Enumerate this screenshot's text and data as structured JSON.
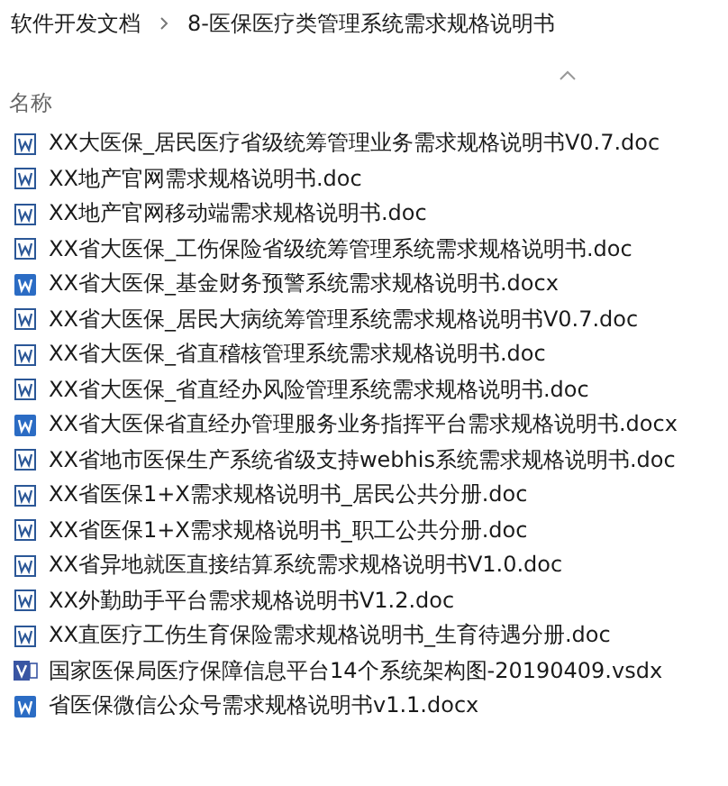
{
  "breadcrumb": [
    {
      "label": "软件开发文档"
    },
    {
      "label": "8-医保医疗类管理系统需求规格说明书"
    }
  ],
  "column_header": {
    "label": "名称",
    "sorted_ascending": true
  },
  "files": [
    {
      "name": "XX大医保_居民医疗省级统筹管理业务需求规格说明书V0.7.doc",
      "kind": "doc"
    },
    {
      "name": "XX地产官网需求规格说明书.doc",
      "kind": "doc"
    },
    {
      "name": "XX地产官网移动端需求规格说明书.doc",
      "kind": "doc"
    },
    {
      "name": "XX省大医保_工伤保险省级统筹管理系统需求规格说明书.doc",
      "kind": "doc"
    },
    {
      "name": "XX省大医保_基金财务预警系统需求规格说明书.docx",
      "kind": "docx"
    },
    {
      "name": "XX省大医保_居民大病统筹管理系统需求规格说明书V0.7.doc",
      "kind": "doc"
    },
    {
      "name": "XX省大医保_省直稽核管理系统需求规格说明书.doc",
      "kind": "doc"
    },
    {
      "name": "XX省大医保_省直经办风险管理系统需求规格说明书.doc",
      "kind": "doc"
    },
    {
      "name": "XX省大医保省直经办管理服务业务指挥平台需求规格说明书.docx",
      "kind": "docx"
    },
    {
      "name": "XX省地市医保生产系统省级支持webhis系统需求规格说明书.doc",
      "kind": "doc"
    },
    {
      "name": "XX省医保1+X需求规格说明书_居民公共分册.doc",
      "kind": "doc"
    },
    {
      "name": "XX省医保1+X需求规格说明书_职工公共分册.doc",
      "kind": "doc"
    },
    {
      "name": "XX省异地就医直接结算系统需求规格说明书V1.0.doc",
      "kind": "doc"
    },
    {
      "name": "XX外勤助手平台需求规格说明书V1.2.doc",
      "kind": "doc"
    },
    {
      "name": "XX直医疗工伤生育保险需求规格说明书_生育待遇分册.doc",
      "kind": "doc"
    },
    {
      "name": "国家医保局医疗保障信息平台14个系统架构图-20190409.vsdx",
      "kind": "vsdx"
    },
    {
      "name": "省医保微信公众号需求规格说明书v1.1.docx",
      "kind": "docx"
    }
  ]
}
